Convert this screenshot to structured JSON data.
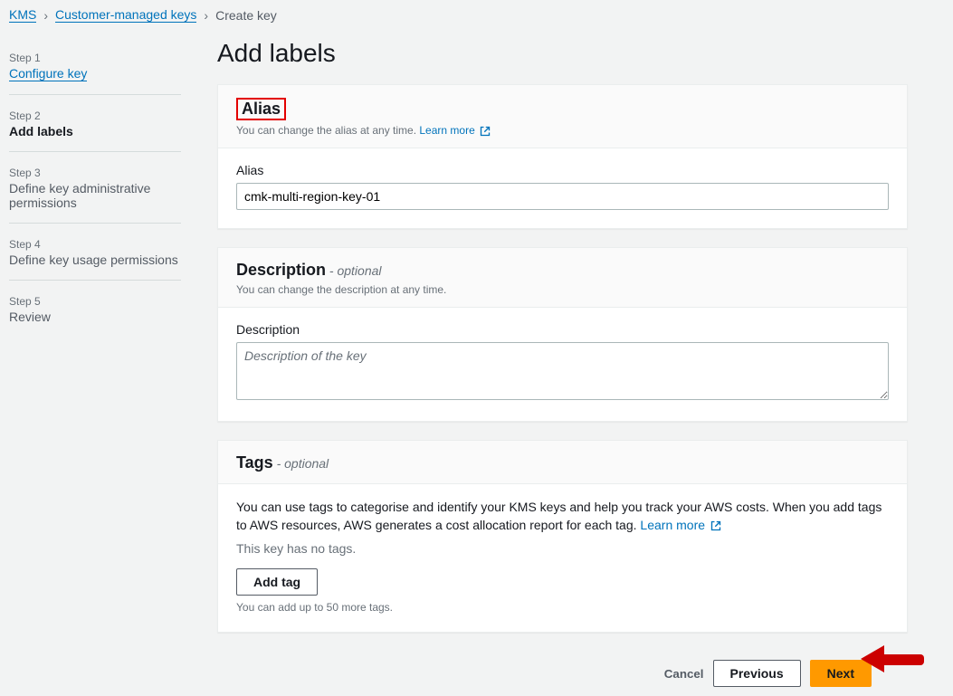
{
  "breadcrumb": {
    "root": "KMS",
    "mid": "Customer-managed keys",
    "current": "Create key"
  },
  "sidebar": {
    "steps": [
      {
        "num": "Step 1",
        "title": "Configure key"
      },
      {
        "num": "Step 2",
        "title": "Add labels"
      },
      {
        "num": "Step 3",
        "title": "Define key administrative permissions"
      },
      {
        "num": "Step 4",
        "title": "Define key usage permissions"
      },
      {
        "num": "Step 5",
        "title": "Review"
      }
    ]
  },
  "page": {
    "title": "Add labels"
  },
  "alias": {
    "heading": "Alias",
    "sub": "You can change the alias at any time.",
    "learn": "Learn more",
    "label": "Alias",
    "value": "cmk-multi-region-key-01"
  },
  "description": {
    "heading": "Description",
    "optional": "- optional",
    "sub": "You can change the description at any time.",
    "label": "Description",
    "placeholder": "Description of the key"
  },
  "tags": {
    "heading": "Tags",
    "optional": "- optional",
    "text": "You can use tags to categorise and identify your KMS keys and help you track your AWS costs. When you add tags to AWS resources, AWS generates a cost allocation report for each tag.",
    "learn": "Learn more",
    "no_tags": "This key has no tags.",
    "add_btn": "Add tag",
    "hint": "You can add up to 50 more tags."
  },
  "footer": {
    "cancel": "Cancel",
    "previous": "Previous",
    "next": "Next"
  }
}
